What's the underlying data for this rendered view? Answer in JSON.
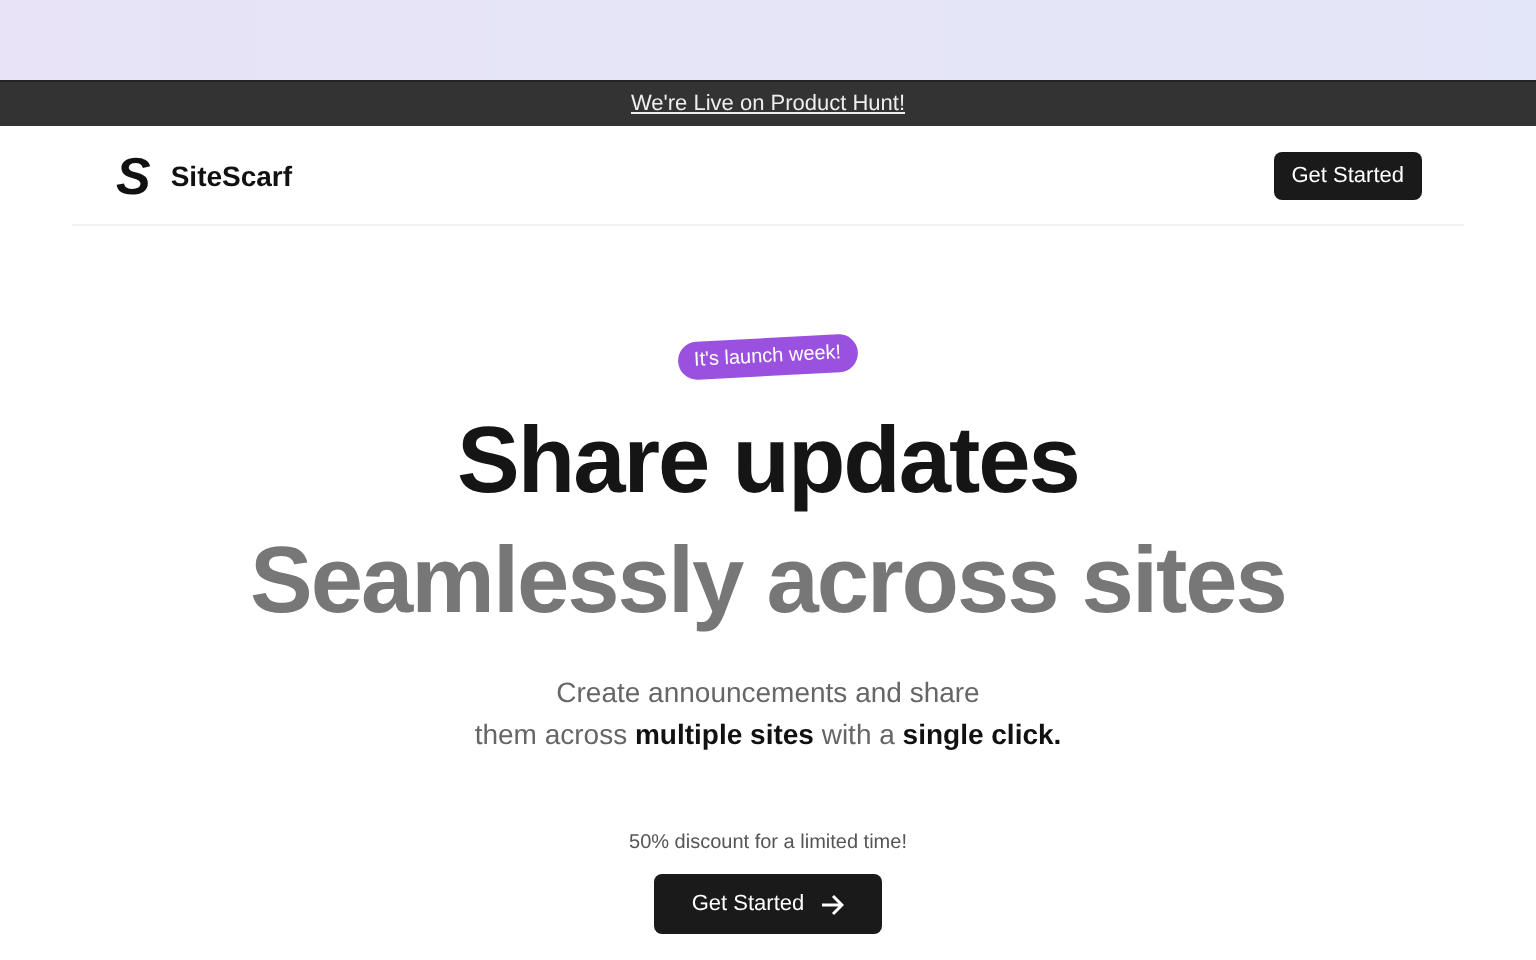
{
  "announcement_bar": {
    "link": "We're Live on Product Hunt!"
  },
  "header": {
    "logo_mark": "S",
    "brand": "SiteScarf",
    "cta": "Get Started"
  },
  "hero": {
    "badge": "It's launch week!",
    "headline": "Share updates",
    "subheadline": "Seamlessly across sites",
    "description": "Create announcements and share\nthem across **multiple sites** with a **single click.**",
    "offer": "50% discount for a limited time!",
    "cta": "Get Started"
  }
}
